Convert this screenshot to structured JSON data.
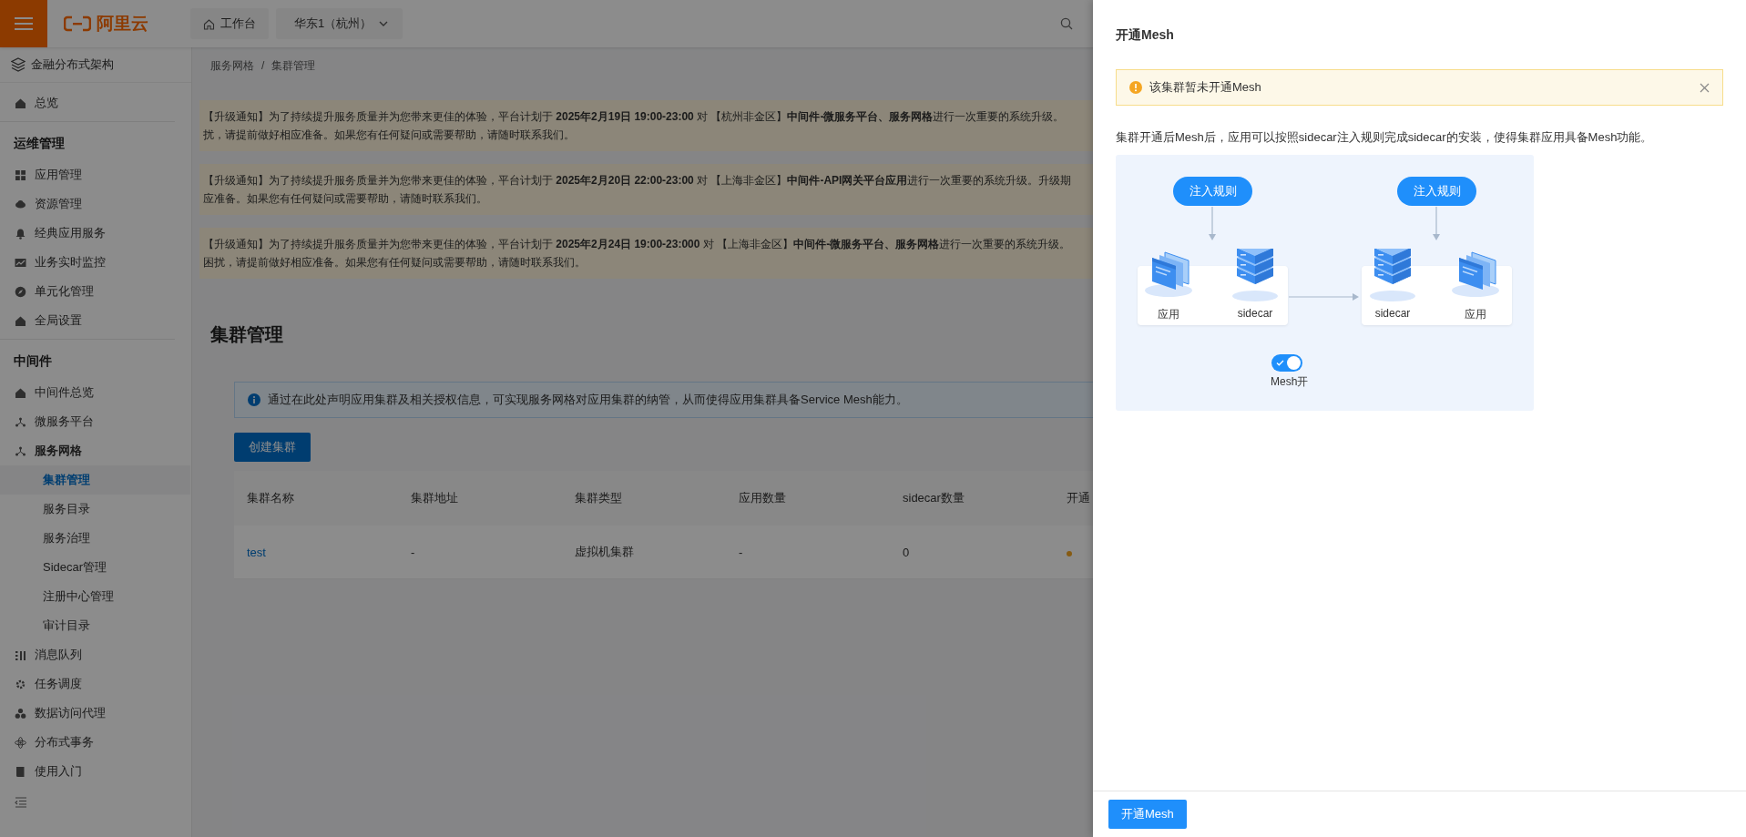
{
  "topbar": {
    "logo": "阿里云",
    "workbench": "工作台",
    "region": "华东1（杭州）"
  },
  "sidebar": {
    "product": "金融分布式架构",
    "sections": [
      {
        "items": [
          {
            "label": "总览",
            "selected": false
          }
        ]
      },
      {
        "title": "运维管理",
        "items": [
          {
            "label": "应用管理",
            "selected": false
          },
          {
            "label": "资源管理",
            "selected": false
          },
          {
            "label": "经典应用服务",
            "selected": false
          },
          {
            "label": "业务实时监控",
            "selected": false
          },
          {
            "label": "单元化管理",
            "selected": false
          },
          {
            "label": "全局设置",
            "selected": false
          }
        ]
      },
      {
        "title": "中间件",
        "items": [
          {
            "label": "中间件总览",
            "selected": false
          },
          {
            "label": "微服务平台",
            "selected": false
          },
          {
            "label": "服务网格",
            "selected": false,
            "expanded": true,
            "children": [
              {
                "label": "集群管理",
                "selected": true
              },
              {
                "label": "服务目录",
                "selected": false
              },
              {
                "label": "服务治理",
                "selected": false
              },
              {
                "label": "Sidecar管理",
                "selected": false
              },
              {
                "label": "注册中心管理",
                "selected": false
              },
              {
                "label": "审计目录",
                "selected": false
              }
            ]
          },
          {
            "label": "消息队列",
            "selected": false
          },
          {
            "label": "任务调度",
            "selected": false
          },
          {
            "label": "数据访问代理",
            "selected": false
          },
          {
            "label": "分布式事务",
            "selected": false
          },
          {
            "label": "使用入门",
            "selected": false
          }
        ]
      }
    ]
  },
  "breadcrumb": [
    "服务网格",
    "/",
    "集群管理"
  ],
  "notices": [
    {
      "lines": [
        "【升级通知】为了持续提升服务质量并为您带来更佳的体验，平台计划于 **2025年2月19日 19:00-23:00** 对 【杭州非金区】**中间件-微服务平台、服务网格**进行一次重要的系统升级。",
        "扰，请提前做好相应准备。如果您有任何疑问或需要帮助，请随时联系我们。"
      ]
    },
    {
      "lines": [
        "【升级通知】为了持续提升服务质量并为您带来更佳的体验，平台计划于 **2025年2月20日 22:00-23:00** 对 【上海非金区】**中间件-API网关平台应用**进行一次重要的系统升级。升级期",
        "应准备。如果您有任何疑问或需要帮助，请随时联系我们。"
      ]
    },
    {
      "lines": [
        "【升级通知】为了持续提升服务质量并为您带来更佳的体验，平台计划于 **2025年2月24日 19:00-23:000** 对 【上海非金区】**中间件-微服务平台、服务网格**进行一次重要的系统升级。",
        "困扰，请提前做好相应准备。如果您有任何疑问或需要帮助，请随时联系我们。"
      ]
    }
  ],
  "page_title": "集群管理",
  "info": "通过在此处声明应用集群及相关授权信息，可实现服务网格对应用集群的纳管，从而使得应用集群具备Service Mesh能力。",
  "create_button": "创建集群",
  "table": {
    "columns": [
      "集群名称",
      "集群地址",
      "集群类型",
      "应用数量",
      "sidecar数量",
      "开通"
    ],
    "rows": [
      {
        "cells": [
          "test",
          "-",
          "虚拟机集群",
          "-",
          "0"
        ]
      }
    ]
  },
  "drawer": {
    "title": "开通Mesh",
    "warning": "该集群暂未开通Mesh",
    "description": "集群开通后Mesh后，应用可以按照sidecar注入规则完成sidecar的安装，使得集群应用具备Mesh功能。",
    "diagram": {
      "rules": [
        "注入规则",
        "注入规则"
      ],
      "cards": [
        {
          "labels": [
            "应用",
            "sidecar"
          ]
        },
        {
          "labels": [
            "sidecar",
            "应用"
          ]
        }
      ],
      "toggle": {
        "label": "Mesh开",
        "on": true
      }
    },
    "button": "开通Mesh"
  }
}
